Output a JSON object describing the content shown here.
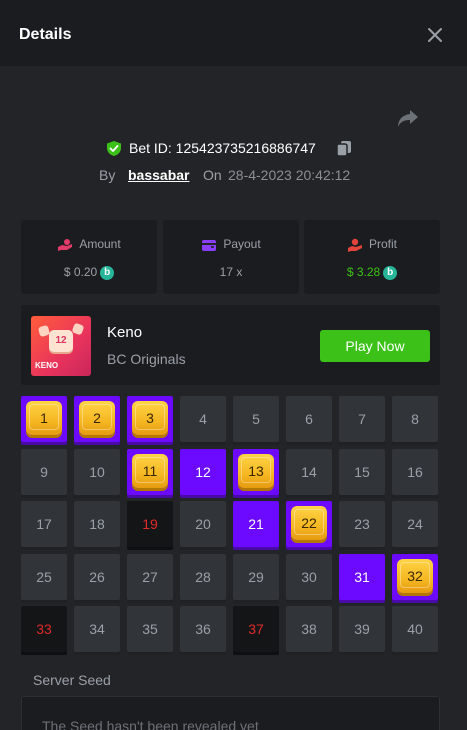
{
  "header": {
    "title": "Details"
  },
  "bet": {
    "id_text": "Bet ID: 125423735216886747",
    "by_label": "By",
    "username": "bassabar",
    "on_label": "On",
    "date": "28-4-2023 20:42:12"
  },
  "stats": {
    "amount": {
      "label": "Amount",
      "value": "$ 0.20"
    },
    "payout": {
      "label": "Payout",
      "value": "17 x"
    },
    "profit": {
      "label": "Profit",
      "value": "$ 3.28"
    }
  },
  "game": {
    "name": "Keno",
    "provider": "BC Originals",
    "play_label": "Play Now",
    "thumb_ball": "12",
    "thumb_text": "KENO"
  },
  "board": {
    "tiles": [
      {
        "n": "1",
        "s": "gem"
      },
      {
        "n": "2",
        "s": "gem"
      },
      {
        "n": "3",
        "s": "gem"
      },
      {
        "n": "4",
        "s": "none"
      },
      {
        "n": "5",
        "s": "none"
      },
      {
        "n": "6",
        "s": "none"
      },
      {
        "n": "7",
        "s": "none"
      },
      {
        "n": "8",
        "s": "none"
      },
      {
        "n": "9",
        "s": "none"
      },
      {
        "n": "10",
        "s": "none"
      },
      {
        "n": "11",
        "s": "gem"
      },
      {
        "n": "12",
        "s": "purple"
      },
      {
        "n": "13",
        "s": "gem"
      },
      {
        "n": "14",
        "s": "none"
      },
      {
        "n": "15",
        "s": "none"
      },
      {
        "n": "16",
        "s": "none"
      },
      {
        "n": "17",
        "s": "none"
      },
      {
        "n": "18",
        "s": "none"
      },
      {
        "n": "19",
        "s": "miss"
      },
      {
        "n": "20",
        "s": "none"
      },
      {
        "n": "21",
        "s": "purple"
      },
      {
        "n": "22",
        "s": "gem"
      },
      {
        "n": "23",
        "s": "none"
      },
      {
        "n": "24",
        "s": "none"
      },
      {
        "n": "25",
        "s": "none"
      },
      {
        "n": "26",
        "s": "none"
      },
      {
        "n": "27",
        "s": "none"
      },
      {
        "n": "28",
        "s": "none"
      },
      {
        "n": "29",
        "s": "none"
      },
      {
        "n": "30",
        "s": "none"
      },
      {
        "n": "31",
        "s": "purple"
      },
      {
        "n": "32",
        "s": "gem"
      },
      {
        "n": "33",
        "s": "miss"
      },
      {
        "n": "34",
        "s": "none"
      },
      {
        "n": "35",
        "s": "none"
      },
      {
        "n": "36",
        "s": "none"
      },
      {
        "n": "37",
        "s": "miss"
      },
      {
        "n": "38",
        "s": "none"
      },
      {
        "n": "39",
        "s": "none"
      },
      {
        "n": "40",
        "s": "none"
      }
    ]
  },
  "seed": {
    "label": "Server Seed",
    "value": "The Seed hasn't been revealed yet"
  },
  "colors": {
    "accent_green": "#3bc117",
    "accent_purple": "#6b0aff",
    "gem_gold": "#f5b722",
    "miss_red": "#e02a2a",
    "coin_teal": "#27b59a"
  },
  "icons": {
    "close": "close-icon",
    "share": "share-icon",
    "verified": "shield-check-icon",
    "copy": "copy-icon",
    "amount": "coins-hand-icon",
    "payout": "wallet-icon",
    "profit": "profit-hand-icon",
    "coin": "bc-coin-icon"
  }
}
